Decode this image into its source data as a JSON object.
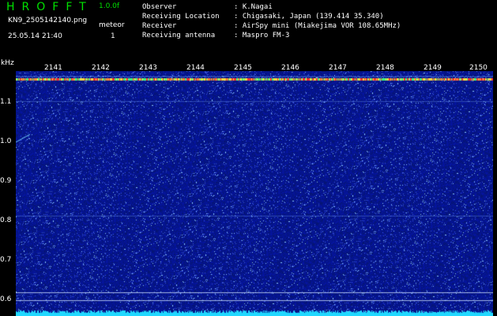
{
  "header": {
    "logo": "HROFFT",
    "version": "1.0.0f",
    "filename": "KN9_2505142140.png",
    "datetime": "25.05.14 21:40",
    "meteor_label": "meteor",
    "meteor_count": "1"
  },
  "info": [
    {
      "label": "Observer",
      "value": ": K.Nagai"
    },
    {
      "label": "Receiving Location",
      "value": ": Chigasaki, Japan (139.414 35.340)"
    },
    {
      "label": "Receiver",
      "value": ": AirSpy mini (Miakejima VOR 108.65MHz)"
    },
    {
      "label": "Receiving antenna",
      "value": ": Maspro FM-3"
    }
  ],
  "axes": {
    "y_unit": "kHz",
    "y_ticks": [
      "1.1",
      "1.0",
      "0.9",
      "0.8",
      "0.7",
      "0.6"
    ],
    "x_ticks": [
      "2141",
      "2142",
      "2143",
      "2144",
      "2145",
      "2146",
      "2147",
      "2148",
      "2149",
      "2150"
    ]
  },
  "colors": {
    "background": "#000000",
    "noise": "#0a1f8c",
    "signal": "#ff3030",
    "text": "#ffffff",
    "logo": "#00e000"
  }
}
